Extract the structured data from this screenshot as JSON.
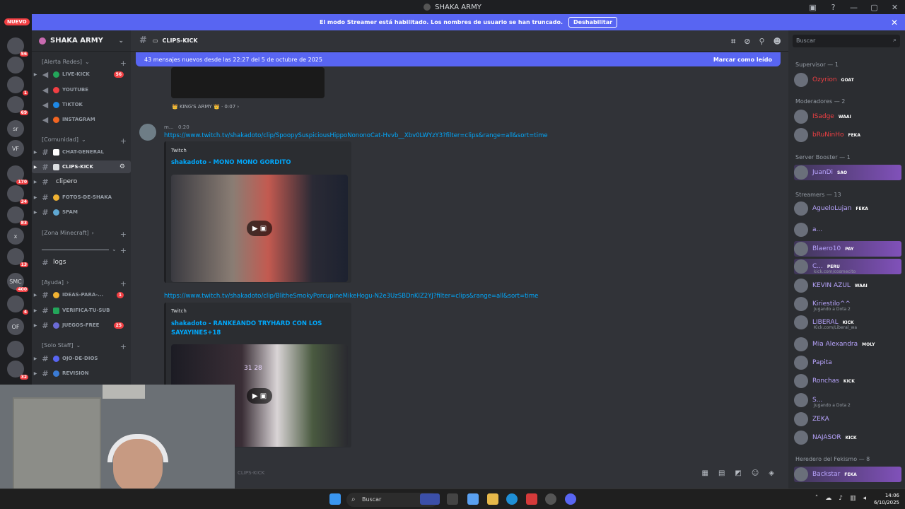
{
  "window": {
    "title": "SHAKA ARMY",
    "controls": [
      "—",
      "▢",
      "✕"
    ]
  },
  "banner": {
    "text": "El modo Streamer está habilitado. Los nombres de usuario se han truncado.",
    "button": "Deshabilitar"
  },
  "servers": {
    "new_label": "NUEVO",
    "items": [
      {
        "label": "",
        "badge": "56"
      },
      {
        "label": "",
        "badge": ""
      },
      {
        "label": "",
        "badge": "1"
      },
      {
        "label": "",
        "badge": "69"
      },
      {
        "label": "sr",
        "badge": ""
      },
      {
        "label": "VF",
        "badge": ""
      },
      {
        "label": "",
        "badge": "170"
      },
      {
        "label": "",
        "badge": "34"
      },
      {
        "label": "",
        "badge": "83"
      },
      {
        "label": "x",
        "badge": ""
      },
      {
        "label": "",
        "badge": "13"
      },
      {
        "label": "SMC",
        "badge": "400"
      },
      {
        "label": "",
        "badge": "4"
      },
      {
        "label": "OF",
        "badge": ""
      },
      {
        "label": "",
        "badge": ""
      },
      {
        "label": "",
        "badge": "32"
      }
    ]
  },
  "guild": {
    "name": "SHAKA ARMY"
  },
  "categories": {
    "alerta": "[Alerta Redes]",
    "comunidad": "[Comunidad]",
    "zona": "[Zona Minecraft]",
    "ayuda": "[Ayuda]",
    "staff": "[Solo Staff]"
  },
  "channels": [
    {
      "name": "LIVE-KICK",
      "count": "56"
    },
    {
      "name": "YOUTUBE",
      "count": ""
    },
    {
      "name": "TIKTOK",
      "count": ""
    },
    {
      "name": "INSTAGRAM",
      "count": ""
    },
    {
      "name": "CHAT-GENERAL",
      "count": ""
    },
    {
      "name": "CLIPS-KICK",
      "count": ""
    },
    {
      "name": "clipero",
      "count": ""
    },
    {
      "name": "FOTOS-DE-SHAKA",
      "count": ""
    },
    {
      "name": "SPAM",
      "count": ""
    },
    {
      "name": "logs",
      "count": ""
    },
    {
      "name": "IDEAS-PARA-...",
      "count": "1"
    },
    {
      "name": "VERIFICA-TU-SUB",
      "count": ""
    },
    {
      "name": "JUEGOS-FREE",
      "count": "25"
    },
    {
      "name": "OJO-DE-DIOS",
      "count": ""
    },
    {
      "name": "REVISION",
      "count": ""
    }
  ],
  "chat": {
    "channel": "CLIPS-KICK",
    "new_messages": "43 mensajes nuevos desde las 22:27 del 5 de octubre de 2025",
    "mark_read": "Marcar como leído",
    "prev_attachment": "👑 KING'S ARMY 👑 · 0:07 ›",
    "author": "m...",
    "time": "0:20",
    "link1": "https://www.twitch.tv/shakadoto/clip/SpoopySuspiciousHippoNononoCat-Hvvb__Xbv0LWYzY3?filter=clips&range=all&sort=time",
    "provider1": "Twitch",
    "title1": "shakadoto - MONO MONO GORDITO",
    "link2": "https://www.twitch.tv/shakadoto/clip/BlitheSmokyPorcupineMikeHogu-N2e3UzSBDnKIZ2YJ?filter=clips&range=all&sort=time",
    "provider2": "Twitch",
    "title2": "shakadoto - RANKEANDO TRYHARD  CON LOS SAYAYINES+18",
    "score": "31  28",
    "composer_placeholder": "CLIPS-KICK"
  },
  "members": {
    "search_placeholder": "Buscar",
    "groups": [
      "Supervisor — 1",
      "Moderadores — 2",
      "Server Booster — 1",
      "Streamers — 13",
      "Heredero del Fekismo — 8"
    ],
    "list": [
      {
        "name": "Ozyrion",
        "tag": "GOAT",
        "sub": ""
      },
      {
        "name": "ISadge",
        "tag": "WAAI",
        "sub": ""
      },
      {
        "name": "bRuNinHo",
        "tag": "FEKA",
        "sub": ""
      },
      {
        "name": "JuanDi",
        "tag": "SAO",
        "sub": ""
      },
      {
        "name": "AgueloLujan",
        "tag": "FEKA",
        "sub": ""
      },
      {
        "name": "a...",
        "tag": "",
        "sub": ""
      },
      {
        "name": "Blaero10",
        "tag": "PAY",
        "sub": ""
      },
      {
        "name": "C...",
        "tag": "PERU",
        "sub": "kick.com/cosmecito"
      },
      {
        "name": "KEVIN AZUL",
        "tag": "WAAI",
        "sub": ""
      },
      {
        "name": "Kiriestilo^^",
        "tag": "",
        "sub": "Jugando a Dota 2"
      },
      {
        "name": "LIBERAL",
        "tag": "KICK",
        "sub": "Kick.com/Liberal_wa"
      },
      {
        "name": "Mia Alexandra",
        "tag": "MOLY",
        "sub": ""
      },
      {
        "name": "Papita",
        "tag": "",
        "sub": ""
      },
      {
        "name": "Ronchas",
        "tag": "KICK",
        "sub": ""
      },
      {
        "name": "S...",
        "tag": "",
        "sub": "Jugando a Dota 2"
      },
      {
        "name": "ZEKA",
        "tag": "",
        "sub": ""
      },
      {
        "name": "NAJASOR",
        "tag": "KICK",
        "sub": ""
      },
      {
        "name": "Backstar",
        "tag": "FEKA",
        "sub": ""
      }
    ]
  },
  "taskbar": {
    "search": "Buscar",
    "time": "14:06",
    "date": "6/10/2025"
  }
}
